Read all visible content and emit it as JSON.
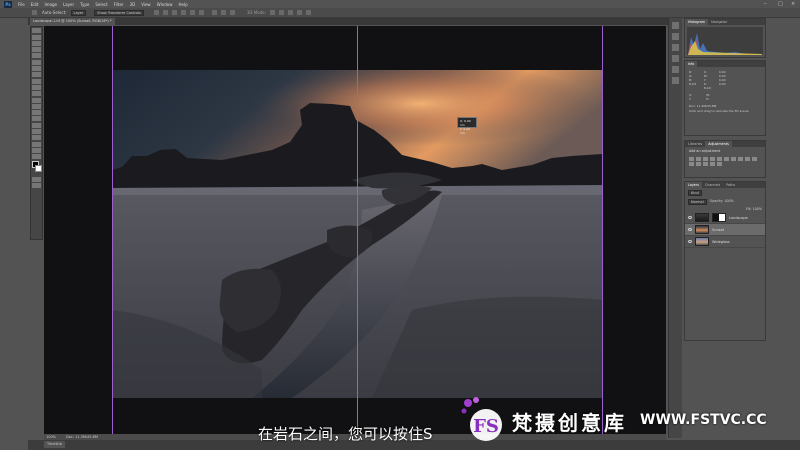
{
  "app": {
    "title": "Adobe Photoshop",
    "menu": [
      "File",
      "Edit",
      "Image",
      "Layer",
      "Type",
      "Select",
      "Filter",
      "3D",
      "View",
      "Window",
      "Help"
    ]
  },
  "options_bar": {
    "auto_select_label": "Auto-Select:",
    "auto_select_value": "Layer",
    "transform_label": "Show Transform Controls",
    "mode_3d": "3D Mode:"
  },
  "document": {
    "tab_title": "Landscape-1.tif @ 100% (Sunset, RGB/16*) *",
    "zoom": "100%",
    "doc_info": "Doc: 11.3M/45.8M"
  },
  "bottom_tab": "Timeline",
  "tooltip": {
    "line1": "X: 0.00 cm",
    "line2": "Y: 0.00 cm"
  },
  "panels": {
    "histogram_tabs": [
      "Histogram",
      "Navigator"
    ],
    "info_tab": "Info",
    "info_rgb": [
      "R:",
      "G:",
      "B:",
      "8-bit"
    ],
    "info_cmyk": [
      "C:",
      "M:",
      "Y:",
      "K:",
      "8-bit"
    ],
    "info_xy": [
      "X:",
      "Y:"
    ],
    "info_wh": [
      "W:",
      "H:"
    ],
    "info_values": [
      "0.00",
      "0.00",
      "0.00",
      "0.00"
    ],
    "info_doc": "Doc: 11.3M/45.8M",
    "info_hint": "Click and drag to relocate the 3D scene.",
    "adj_tabs": [
      "Libraries",
      "Adjustments"
    ],
    "adj_title": "Add an adjustment",
    "layers_tabs": [
      "Layers",
      "Channels",
      "Paths"
    ],
    "layers_kind": "Kind",
    "layers_blend": "Normal",
    "layers_opacity": "Opacity: 100%",
    "layers_fill": "Fill: 100%",
    "layers": [
      {
        "name": "Landscape"
      },
      {
        "name": "Sunset"
      },
      {
        "name": "Wideglass"
      }
    ]
  },
  "subtitle": "在岩石之间，您可以按住S",
  "watermark": {
    "brand": "梵摄创意库",
    "url": "WWW.FSTVC.CC",
    "logo": "FS"
  },
  "colors": {
    "ps_bg": "#535353",
    "canvas_bg": "#111113",
    "guide": "#9d5fd0",
    "sky_top": "#1f2a38",
    "sky_glow": "#f2a86a",
    "rock": "#1c1c1e",
    "sand": "#4a4b52",
    "water": "#2a3140"
  }
}
